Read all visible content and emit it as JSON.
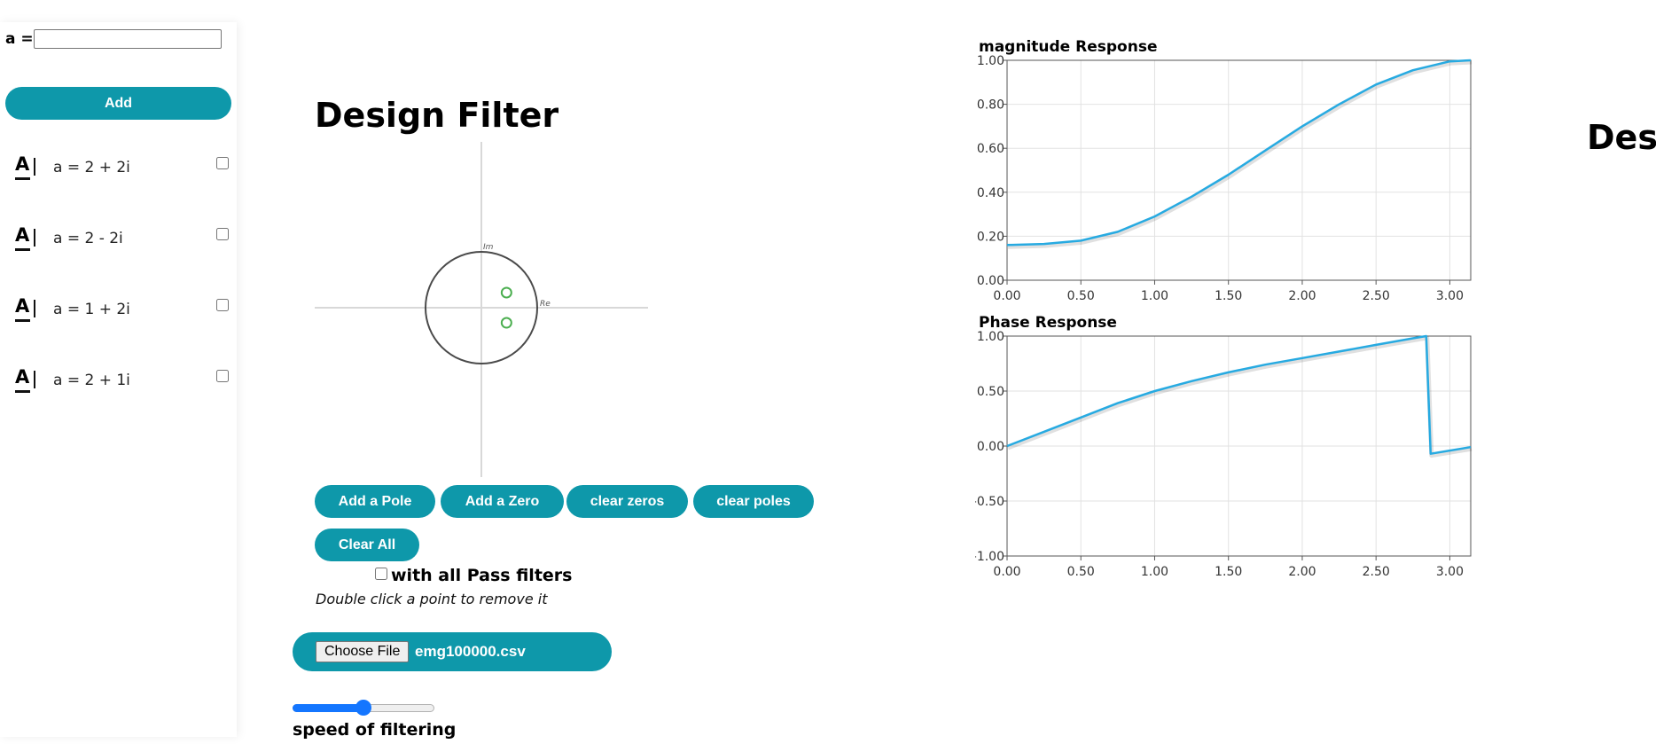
{
  "sidebar": {
    "a_label": "a =",
    "a_input_value": "",
    "add_label": "Add",
    "items": [
      {
        "icon": "text-format-icon",
        "text": "a = 2 + 2i",
        "checked": false
      },
      {
        "icon": "text-format-icon",
        "text": "a = 2 - 2i",
        "checked": false
      },
      {
        "icon": "text-format-icon",
        "text": "a = 1 + 2i",
        "checked": false
      },
      {
        "icon": "text-format-icon",
        "text": "a = 2 + 1i",
        "checked": false
      }
    ]
  },
  "designer": {
    "title": "Design Filter",
    "side_title": "Desi",
    "zplane": {
      "im_label": "Im",
      "re_label": "Re",
      "zeros": [
        {
          "re": 0.45,
          "im": 0.27
        },
        {
          "re": 0.45,
          "im": -0.27
        }
      ],
      "poles": []
    },
    "buttons": {
      "add_pole": "Add a Pole",
      "add_zero": "Add a Zero",
      "clear_zeros": "clear zeros",
      "clear_poles": "clear poles",
      "clear_all": "Clear All"
    },
    "all_pass_label": "with all Pass filters",
    "all_pass_checked": false,
    "hint": "Double click a point to remove it",
    "file": {
      "choose_label": "Choose File",
      "file_name": "emg100000.csv"
    },
    "speed": {
      "label": "speed of filtering",
      "value_fraction": 0.5
    }
  },
  "colors": {
    "accent": "#0e98aa",
    "series": "#27aae1",
    "slider": "#1476ff",
    "zero": "#4caf50"
  },
  "chart_data": [
    {
      "type": "line",
      "title": "magnitude Response",
      "x": [
        0.0,
        0.25,
        0.5,
        0.75,
        1.0,
        1.25,
        1.5,
        1.75,
        2.0,
        2.25,
        2.5,
        2.75,
        3.0,
        3.1416
      ],
      "series": [
        {
          "values": [
            0.16,
            0.165,
            0.18,
            0.22,
            0.29,
            0.38,
            0.48,
            0.59,
            0.7,
            0.8,
            0.89,
            0.955,
            0.995,
            1.0
          ]
        }
      ],
      "xlim": [
        0,
        3.1416
      ],
      "ylim": [
        0,
        1
      ],
      "xticks": [
        "0.00",
        "0.50",
        "1.00",
        "1.50",
        "2.00",
        "2.50",
        "3.00"
      ],
      "yticks": [
        "0.00",
        "0.20",
        "0.40",
        "0.60",
        "0.80",
        "1.00"
      ],
      "grid": true
    },
    {
      "type": "line",
      "title": "Phase Response",
      "x": [
        0.0,
        0.25,
        0.5,
        0.75,
        1.0,
        1.25,
        1.5,
        1.75,
        2.0,
        2.25,
        2.5,
        2.75,
        2.84,
        2.87,
        3.1416
      ],
      "series": [
        {
          "values": [
            0.0,
            0.13,
            0.26,
            0.39,
            0.5,
            0.59,
            0.67,
            0.74,
            0.8,
            0.86,
            0.92,
            0.98,
            1.0,
            -0.07,
            -0.01
          ]
        }
      ],
      "xlim": [
        0,
        3.1416
      ],
      "ylim": [
        -1,
        1
      ],
      "xticks": [
        "0.00",
        "0.50",
        "1.00",
        "1.50",
        "2.00",
        "2.50",
        "3.00"
      ],
      "yticks": [
        "-1.00",
        "-0.50",
        "0.00",
        "0.50",
        "1.00"
      ],
      "grid": true
    }
  ]
}
